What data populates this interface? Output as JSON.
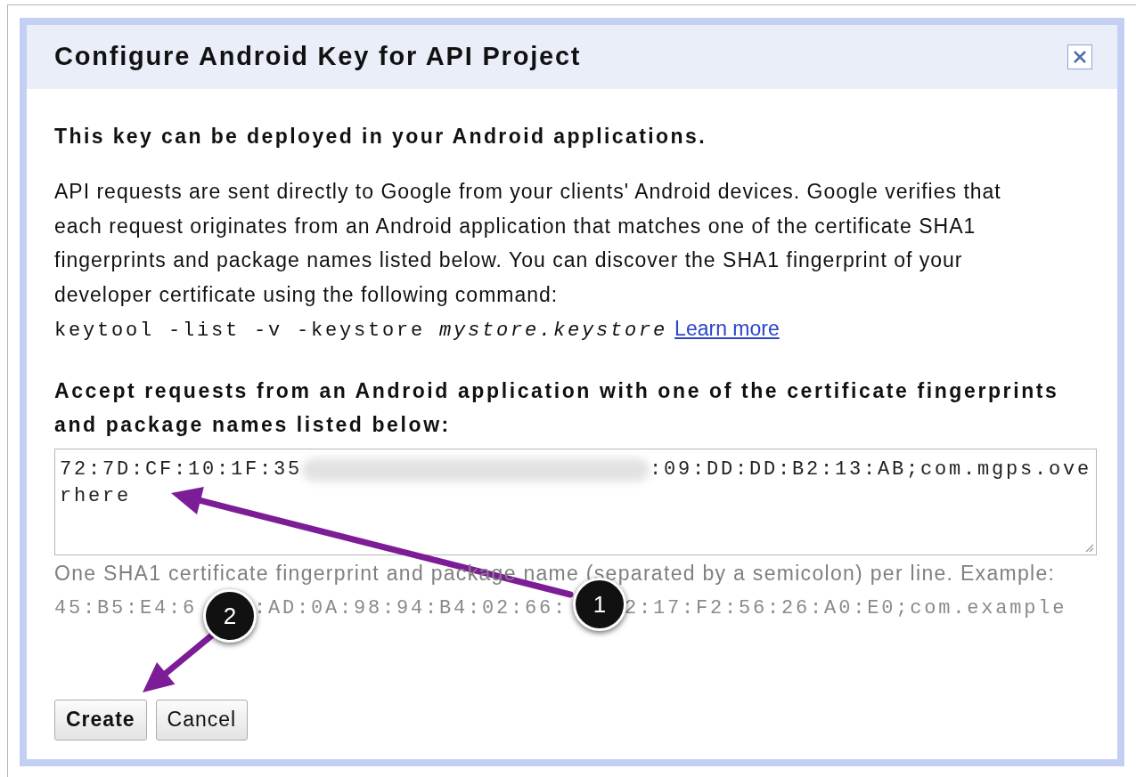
{
  "dialog": {
    "title": "Configure Android Key for API Project",
    "intro": "This key can be deployed in your Android applications.",
    "description": "API requests are sent directly to Google from your clients' Android devices. Google verifies that each request originates from an Android application that matches one of the certificate SHA1 fingerprints and package names listed below. You can discover the SHA1 fingerprint of your developer certificate using the following command:",
    "command": "keytool -list -v -keystore *mystore.keystore*",
    "learn_more_link": "Learn more",
    "field_label": "Accept requests from an Android application with one of the certificate fingerprints and package names listed below:",
    "field": {
      "value_start": "72:7D:CF:10:1F:35",
      "value_end": ":09:DD:DD:B2:13:AB;com.mgps.ove",
      "value_wrapped": "rhere"
    },
    "hint": "One SHA1 certificate fingerprint and package name (separated by a semicolon) per line. Example:",
    "example_parts": [
      "45:B5:E4:6",
      ":AD:0A:98:94:B4:02:66:",
      "2:17:F2:56:26:A0:E0;com.example"
    ],
    "buttons": [
      {
        "label": "Create",
        "kind": "primary"
      },
      {
        "label": "Cancel",
        "kind": "secondary"
      }
    ]
  },
  "annotations": [
    {
      "label": "1"
    },
    {
      "label": "2"
    }
  ]
}
